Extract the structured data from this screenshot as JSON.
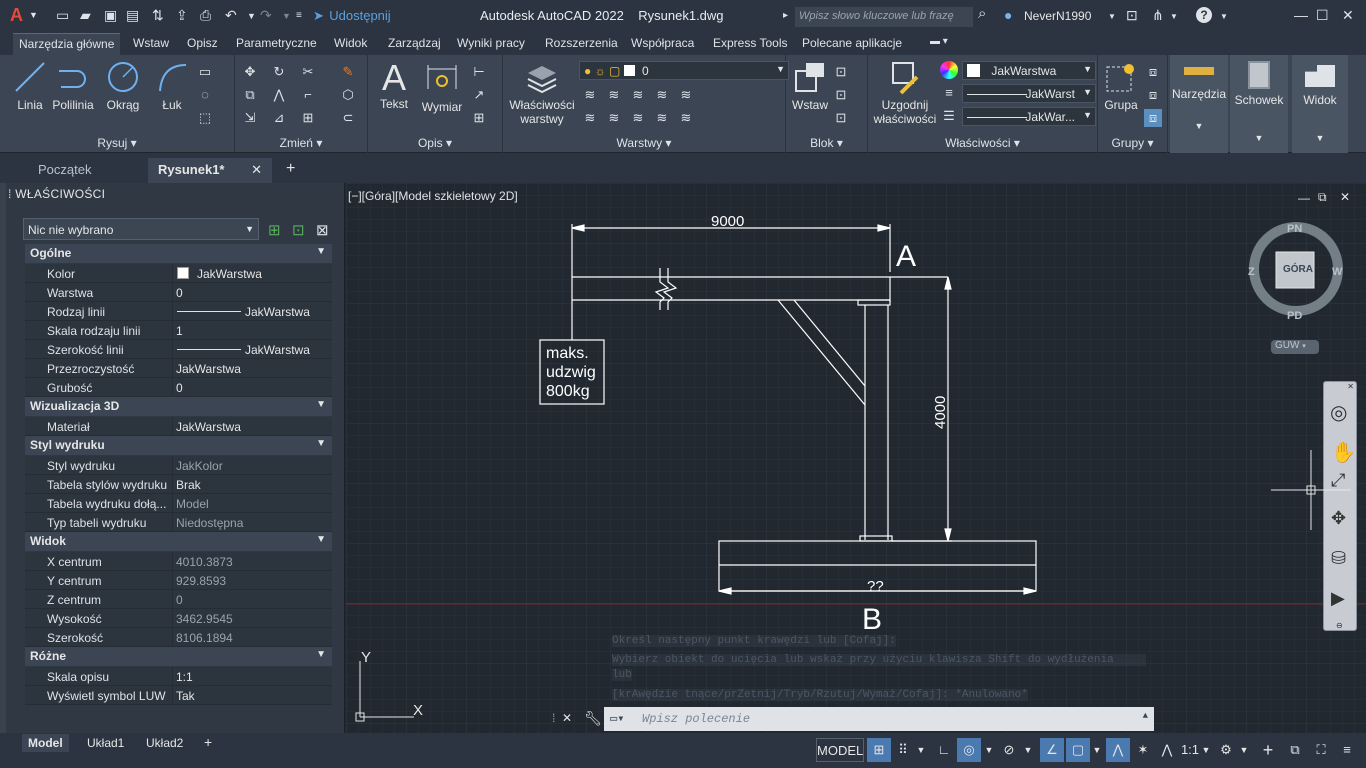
{
  "titlebar": {
    "app_logo": "A",
    "share_label": "Udostępnij",
    "title": "Autodesk AutoCAD 2022    Rysunek1.dwg",
    "search_placeholder": "Wpisz słowo kluczowe lub frazę",
    "user": "NeverN1990"
  },
  "ribbon_tabs": [
    "Narzędzia główne",
    "Wstaw",
    "Opisz",
    "Parametryczne",
    "Widok",
    "Zarządzaj",
    "Wyniki pracy",
    "Rozszerzenia",
    "Współpraca",
    "Express Tools",
    "Polecane aplikacje"
  ],
  "ribbon": {
    "draw": {
      "label": "Rysuj",
      "line": "Linia",
      "polyline": "Polilinia",
      "circle": "Okrąg",
      "arc": "Łuk"
    },
    "modify": {
      "label": "Zmień"
    },
    "annotation": {
      "label": "Opis",
      "text": "Tekst",
      "dimension": "Wymiar"
    },
    "layers": {
      "label": "Warstwy",
      "layer_props": "Właściwości\nwarstwy",
      "current_layer": "0"
    },
    "block": {
      "label": "Blok",
      "insert": "Wstaw"
    },
    "properties": {
      "label": "Właściwości",
      "match": "Uzgodnij\nwłaściwości",
      "color": "JakWarstwa",
      "linetype": "JakWarst",
      "lineweight": "JakWar..."
    },
    "groups": {
      "label": "Grupy",
      "group": "Grupa"
    },
    "utilities": "Narzędzia",
    "clipboard": "Schowek",
    "view": "Widok"
  },
  "doc_tabs": {
    "start": "Początek",
    "drawing": "Rysunek1*"
  },
  "properties_palette": {
    "title": "WŁAŚCIWOŚCI",
    "selection": "Nic nie wybrano",
    "sections": [
      {
        "name": "Ogólne",
        "rows": [
          {
            "k": "Kolor",
            "v": "JakWarstwa"
          },
          {
            "k": "Warstwa",
            "v": "0"
          },
          {
            "k": "Rodzaj linii",
            "v": "JakWarstwa"
          },
          {
            "k": "Skala rodzaju linii",
            "v": "1"
          },
          {
            "k": "Szerokość linii",
            "v": "JakWarstwa"
          },
          {
            "k": "Przezroczystość",
            "v": "JakWarstwa"
          },
          {
            "k": "Grubość",
            "v": "0"
          }
        ]
      },
      {
        "name": "Wizualizacja 3D",
        "rows": [
          {
            "k": "Materiał",
            "v": "JakWarstwa"
          }
        ]
      },
      {
        "name": "Styl wydruku",
        "rows": [
          {
            "k": "Styl wydruku",
            "v": "JakKolor"
          },
          {
            "k": "Tabela stylów wydruku",
            "v": "Brak"
          },
          {
            "k": "Tabela wydruku dołą...",
            "v": "Model"
          },
          {
            "k": "Typ tabeli wydruku",
            "v": "Niedostępna"
          }
        ]
      },
      {
        "name": "Widok",
        "rows": [
          {
            "k": "X centrum",
            "v": "4010.3873"
          },
          {
            "k": "Y centrum",
            "v": "929.8593"
          },
          {
            "k": "Z centrum",
            "v": "0"
          },
          {
            "k": "Wysokość",
            "v": "3462.9545"
          },
          {
            "k": "Szerokość",
            "v": "8106.1894"
          }
        ]
      },
      {
        "name": "Różne",
        "rows": [
          {
            "k": "Skala opisu",
            "v": "1:1"
          },
          {
            "k": "Wyświetl symbol LUW",
            "v": "Tak"
          }
        ]
      }
    ]
  },
  "viewport": {
    "label": "[−][Góra][Model szkieletowy 2D]",
    "dim_top": "9000",
    "dim_side": "4000",
    "dim_bottom": "??",
    "point_a": "A",
    "point_b": "B",
    "note": [
      "maks.",
      "udzwig",
      "800kg"
    ]
  },
  "viewcube": {
    "top": "GÓRA",
    "north": "PN",
    "south": "PD",
    "west": "Z",
    "east": "W",
    "ucs": "GUW"
  },
  "ucs_icon": {
    "y": "Y",
    "x": "X"
  },
  "command": {
    "history": [
      "Określ następny punkt krawędzi lub [Cofaj]:",
      "Wybierz obiekt do ucięcia lub wskaż przy użyciu klawisza Shift do wydłużenia",
      "lub",
      " [krAwędzie tnące/prZetnij/Tryb/Rzutuj/Wymaż/Cofaj]: *Anulowano*"
    ],
    "placeholder": "Wpisz polecenie"
  },
  "layout_tabs": [
    "Model",
    "Układ1",
    "Układ2"
  ],
  "status": {
    "model": "MODEL",
    "scale": "1:1"
  }
}
